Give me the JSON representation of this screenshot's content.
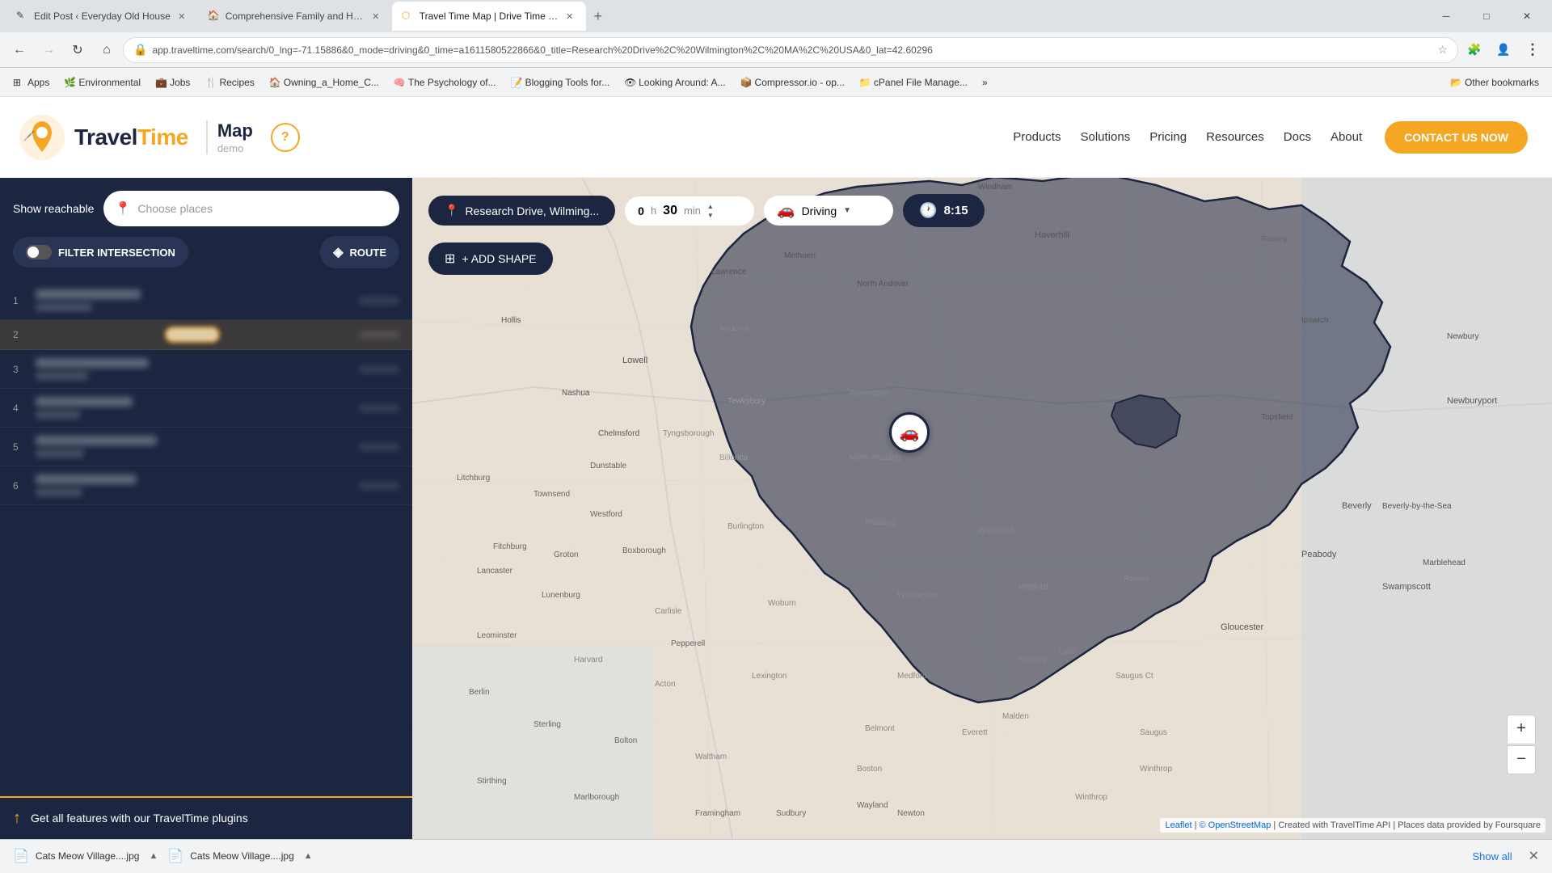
{
  "browser": {
    "tabs": [
      {
        "id": "tab-1",
        "title": "Edit Post ‹ Everyday Old House",
        "favicon_color": "#0a6640",
        "favicon_symbol": "✎",
        "active": false
      },
      {
        "id": "tab-2",
        "title": "Comprehensive Family and Home",
        "favicon_color": "#0a6640",
        "favicon_symbol": "🏠",
        "active": false
      },
      {
        "id": "tab-3",
        "title": "Travel Time Map | Drive Time Ra…",
        "favicon_color": "#f5a623",
        "favicon_symbol": "🗺",
        "active": true
      }
    ],
    "url": "app.traveltime.com/search/0_lng=-71.15886&0_mode=driving&0_time=a1611580522866&0_title=Research%20Drive%2C%20Wilmington%2C%20MA%2C%20USA&0_lat=42.60296",
    "window_controls": {
      "minimize": "─",
      "maximize": "□",
      "close": "✕"
    }
  },
  "bookmarks": [
    {
      "label": "Apps",
      "favicon": "⊞"
    },
    {
      "label": "Environmental",
      "favicon": "🌿"
    },
    {
      "label": "Jobs",
      "favicon": "💼"
    },
    {
      "label": "Recipes",
      "favicon": "🍴"
    },
    {
      "label": "Owning_a_Home_C...",
      "favicon": "🏠"
    },
    {
      "label": "The Psychology of...",
      "favicon": "🧠"
    },
    {
      "label": "Blogging Tools for...",
      "favicon": "📝"
    },
    {
      "label": "Looking Around: A...",
      "favicon": "👁"
    },
    {
      "label": "Compressor.io - op...",
      "favicon": "📦"
    },
    {
      "label": "cPanel File Manage...",
      "favicon": "📁"
    },
    {
      "label": "»",
      "favicon": ""
    },
    {
      "label": "Other bookmarks",
      "favicon": "📂"
    }
  ],
  "header": {
    "logo_left": "Travel",
    "logo_right": "Time",
    "map_label": "Map",
    "demo_label": "demo",
    "help_symbol": "?",
    "nav_items": [
      "Products",
      "Solutions",
      "Pricing",
      "Resources",
      "Docs",
      "About"
    ],
    "cta_label": "CONTACT US NOW"
  },
  "sidebar": {
    "show_reachable_label": "Show reachable",
    "places_placeholder": "Choose places",
    "filter_label": "FILTER INTERSECTION",
    "route_label": "ROUTE",
    "results": [
      {
        "num": "1",
        "blurred": true
      },
      {
        "num": "2",
        "blurred": true,
        "highlighted": true
      },
      {
        "num": "3",
        "blurred": true
      },
      {
        "num": "4",
        "blurred": true
      },
      {
        "num": "5",
        "blurred": true
      },
      {
        "num": "6",
        "blurred": true
      }
    ],
    "banner_text": "Get all features with our TravelTime plugins"
  },
  "map": {
    "location_label": "Research Drive, Wilming...",
    "time_hours": "0",
    "time_hours_label": "h",
    "time_minutes": "30",
    "time_minutes_label": "min",
    "transport_mode": "Driving",
    "time_display": "8:15",
    "add_shape_label": "+ ADD SHAPE",
    "car_symbol": "🚗",
    "zoom_in": "+",
    "zoom_out": "−",
    "attribution_leaflet": "Leaflet",
    "attribution_osm": "© OpenStreetMap",
    "attribution_api": "Created with TravelTime API",
    "attribution_places": "Places data provided by Foursquare"
  },
  "download_bar": {
    "items": [
      {
        "name": "Cats Meow Village....jpg",
        "icon": "📄"
      },
      {
        "name": "Cats Meow Village....jpg",
        "icon": "📄"
      }
    ],
    "show_all_label": "Show all",
    "close_symbol": "✕"
  },
  "colors": {
    "dark_navy": "#1c2640",
    "orange": "#f5a623",
    "map_overlay": "rgba(28,36,64,0.55)",
    "map_bg": "#e8e0d5"
  }
}
